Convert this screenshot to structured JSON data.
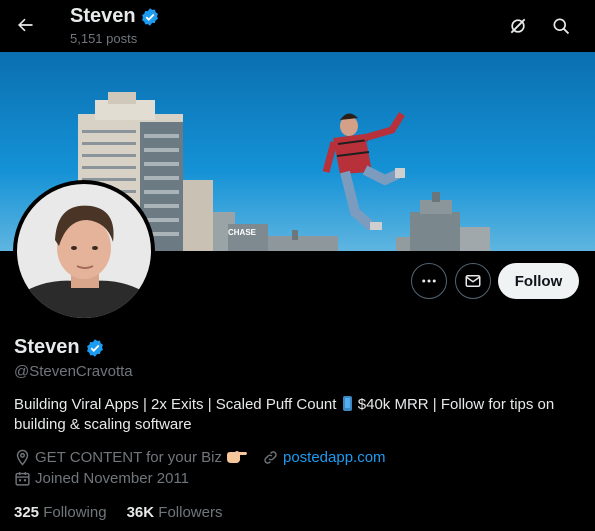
{
  "header": {
    "name": "Steven",
    "posts_count": "5,151 posts"
  },
  "profile": {
    "name": "Steven",
    "handle": "@StevenCravotta",
    "bio_part1": "Building Viral Apps | 2x Exits | Scaled Puff Count",
    "bio_part2": "$40k MRR | Follow for tips on building & scaling software",
    "location": "GET CONTENT for your Biz",
    "website": "postedapp.com",
    "joined": "Joined November 2011"
  },
  "actions": {
    "follow_label": "Follow"
  },
  "stats": {
    "following_count": "325",
    "following_label": "Following",
    "followers_count": "36K",
    "followers_label": "Followers"
  },
  "banner": {
    "sign_text": "CHASE"
  },
  "icons": {
    "back": "arrow-left-icon",
    "grok": "grok-icon",
    "search": "search-icon",
    "more": "more-horizontal-icon",
    "message": "envelope-icon",
    "verified": "verified-badge-icon",
    "location": "location-pin-icon",
    "link": "link-icon",
    "calendar": "calendar-icon"
  },
  "colors": {
    "background": "#000000",
    "accent": "#1d9bf0",
    "secondary_text": "#71767b",
    "sky": "#0e84c4"
  }
}
